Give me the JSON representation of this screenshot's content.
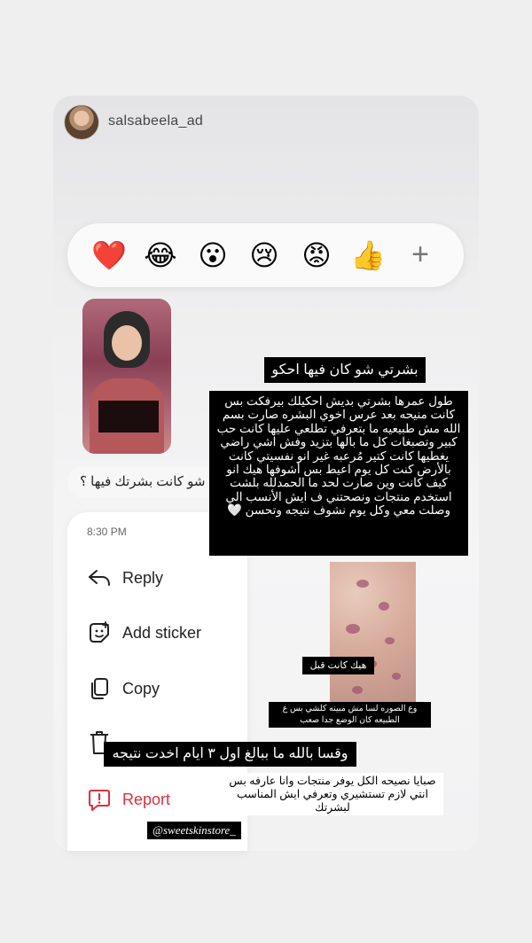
{
  "story": {
    "username": "salsabeela_ad"
  },
  "reactions": {
    "emojis": [
      "❤️",
      "😂",
      "😮",
      "😢",
      "😡",
      "👍"
    ],
    "more": "+"
  },
  "thumb_caption": "",
  "reply_text": "شو كانت بشرتك فيها ؟",
  "menu": {
    "time": "8:30 PM",
    "items": [
      {
        "label": "Reply",
        "icon": "reply-icon"
      },
      {
        "label": "Add sticker",
        "icon": "sticker-icon"
      },
      {
        "label": "Copy",
        "icon": "copy-icon"
      },
      {
        "label": "Report",
        "icon": "report-icon"
      }
    ],
    "colors": {
      "report": "#d9303e"
    }
  },
  "captions": {
    "title": "بشرتي شو كان فيها احكو",
    "story": "طول عمرها بشرتي بديش احكيلك بيرفكت بس كانت منيحه بعد عرس اخوي البشره صارت بسم الله مش طبيعيه ما بتعرفي تطلعي عليها كانت حب كبير وتصبغات كل ما بالها بتزيد وفش اشي راضي يغطيها كانت كتير مُرعبه غير انو نفسيتي كانت بالأرض كنت كل يوم اعيط بس أشوفها هيك انو كيف كانت وين صارت لحد ما الحمدلله بلشت استخدم منتجات ونصحتني ف ايش الأنسب الي وصلت معي وكل يوم نشوف نتيجه وتحسن 🤍",
    "before": "هيك كانت قبل",
    "photo_note": "وع الصوره لسا مش مبينه كلشي بس ع الطبيعه كان الوضع جدا صعب",
    "swear": "وقسا بالله ما ببالغ اول ٣ ايام اخدت نتيجه",
    "advice": "صبايا نصيحه الكل يوفر منتجات وانا عارفه بس انتي لازم تستشيري وتعرفي ايش المناسب لبشرتك",
    "mention": "@sweetskinstore_"
  }
}
